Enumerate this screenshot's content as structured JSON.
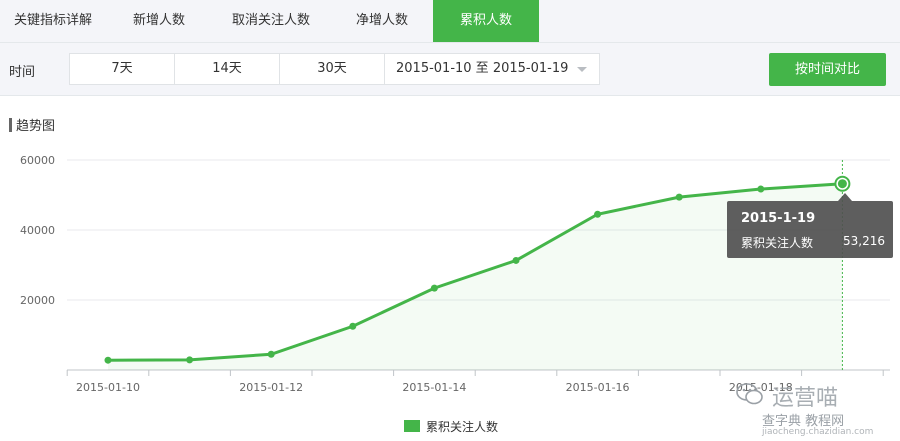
{
  "tabs": [
    {
      "label": "关键指标详解",
      "active": false
    },
    {
      "label": "新增人数",
      "active": false
    },
    {
      "label": "取消关注人数",
      "active": false
    },
    {
      "label": "净增人数",
      "active": false
    },
    {
      "label": "累积人数",
      "active": true
    }
  ],
  "toolbar": {
    "time_label": "时间",
    "ranges": [
      "7天",
      "14天",
      "30天"
    ],
    "date_range": "2015-01-10 至 2015-01-19",
    "compare_button": "按时间对比"
  },
  "section": {
    "title": "趋势图"
  },
  "colors": {
    "accent": "#44b549",
    "tab_bg": "#f4f5f9",
    "tooltip_bg": "#505050"
  },
  "tooltip": {
    "date": "2015-1-19",
    "label": "累积关注人数",
    "value": "53,216"
  },
  "legend": {
    "label": "累积关注人数"
  },
  "watermark": {
    "brand": "运营喵",
    "sub": "查字典 教程网",
    "url": "jiaocheng.chazidian.com",
    "logo_icon": "wechat-icon"
  },
  "chart_data": {
    "type": "area",
    "x": [
      "2015-01-10",
      "2015-01-11",
      "2015-01-12",
      "2015-01-13",
      "2015-01-14",
      "2015-01-15",
      "2015-01-16",
      "2015-01-17",
      "2015-01-18",
      "2015-01-19"
    ],
    "x_tick_labels": [
      "2015-01-10",
      "2015-01-12",
      "2015-01-14",
      "2015-01-16",
      "2015-01-18"
    ],
    "series": [
      {
        "name": "累积关注人数",
        "values": [
          2800,
          2900,
          4500,
          12500,
          23400,
          31300,
          44500,
          49400,
          51700,
          53216
        ]
      }
    ],
    "y_ticks": [
      20000,
      40000,
      60000
    ],
    "ylim": [
      0,
      60000
    ],
    "grid": true,
    "legend": "bottom"
  }
}
